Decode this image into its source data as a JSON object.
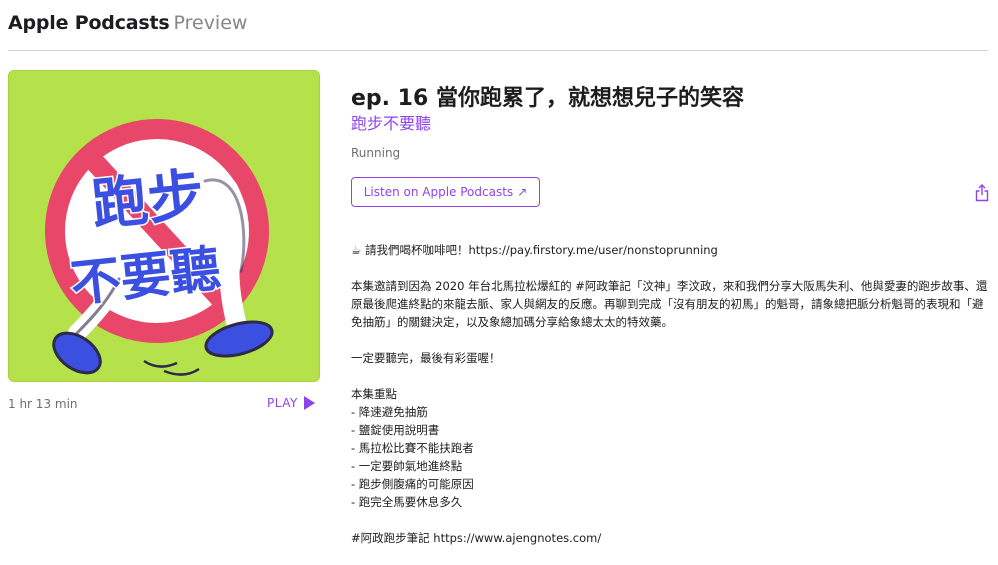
{
  "header": {
    "brand": "Apple Podcasts",
    "sub": "Preview"
  },
  "artwork": {
    "line1": "跑步",
    "line2": "不要聽",
    "bg_color": "#b5e24a"
  },
  "player": {
    "duration": "1 hr 13 min",
    "play_label": "PLAY",
    "icon": "play-icon"
  },
  "episode": {
    "title": "ep. 16 當你跑累了，就想想兒子的笑容",
    "show": "跑步不要聽",
    "category": "Running",
    "listen_label": "Listen on Apple Podcasts",
    "listen_arrow": "↗"
  },
  "description": {
    "coffee_line": "請我們喝杯咖啡吧！https://pay.firstory.me/user/nonstoprunning",
    "paragraph": "本集邀請到因為 2020 年台北馬拉松爆紅的 #阿政筆記「汶神」李汶政，來和我們分享大阪馬失利、他與愛妻的跑步故事、還原最後爬進終點的來龍去脈、家人與網友的反應。再聊到完成「沒有朋友的初馬」的魁哥，請象總把脈分析魁哥的表現和「避免抽筋」的關鍵決定，以及象總加碼分享給象總太太的特效藥。",
    "teaser": "一定要聽完，最後有彩蛋喔！",
    "highlights_title": "本集重點",
    "highlights": [
      "- 降速避免抽筋",
      "- 鹽錠使用說明書",
      "- 馬拉松比賽不能扶跑者",
      "- 一定要帥氣地進終點",
      "- 跑步側腹痛的可能原因",
      "- 跑完全馬要休息多久"
    ],
    "notes_line": "#阿政跑步筆記 https://www.ajengnotes.com/"
  },
  "colors": {
    "accent": "#8e44ec",
    "text": "#1d1d1f",
    "muted": "#6e6e73"
  }
}
